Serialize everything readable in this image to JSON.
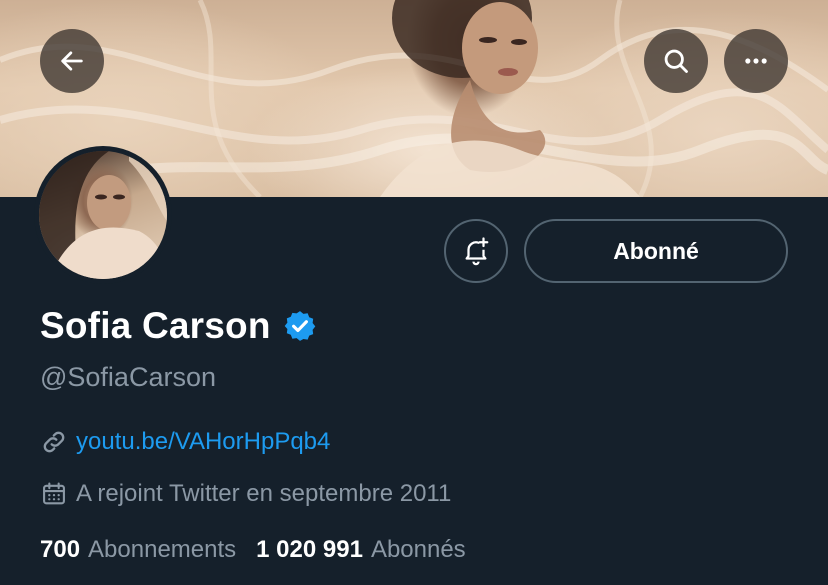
{
  "banner": {
    "description_icon": "banner-image"
  },
  "top_bar": {
    "back_icon": "arrow-left-icon",
    "search_icon": "search-icon",
    "more_icon": "more-horizontal-icon"
  },
  "profile": {
    "name": "Sofia Carson",
    "verified_icon": "verified-badge-icon",
    "verified_color": "#1d9bf0",
    "handle": "@SofiaCarson",
    "link": "youtu.be/VAHorHpPqb4",
    "joined": "A rejoint Twitter en septembre 2011"
  },
  "actions": {
    "notify_icon": "bell-plus-icon",
    "follow_label": "Abonné"
  },
  "stats": {
    "following_count": "700",
    "following_label": "Abonnements",
    "followers_count": "1 020 991",
    "followers_label": "Abonnés"
  },
  "colors": {
    "background": "#15202b",
    "secondary_text": "#8b98a5",
    "link": "#1d9bf0",
    "border": "#536471"
  }
}
